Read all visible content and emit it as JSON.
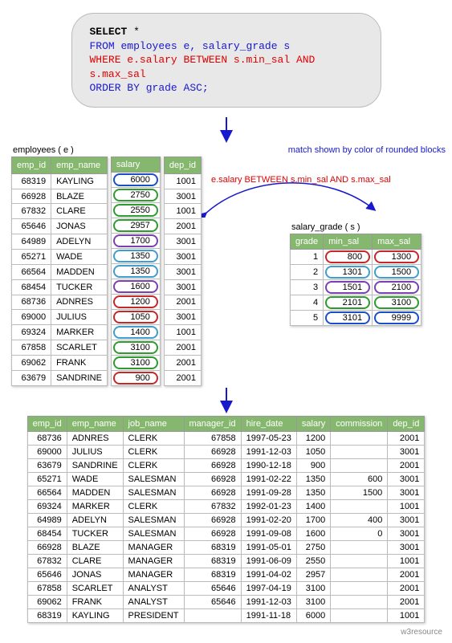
{
  "sql": {
    "select": "SELECT",
    "star": "*",
    "from": "FROM employees e, salary_grade s",
    "where": "WHERE e.salary BETWEEN s.min_sal AND s.max_sal",
    "order": "ORDER BY grade ASC;"
  },
  "notes": {
    "match_color": "match shown by color of rounded blocks",
    "between": "e.salary BETWEEN s.min_sal AND s.max_sal"
  },
  "employees_caption": "employees ( e )",
  "employees_headers": {
    "emp_id": "emp_id",
    "emp_name": "emp_name",
    "salary": "salary",
    "dep_id": "dep_id"
  },
  "employees": [
    {
      "emp_id": "68319",
      "emp_name": "KAYLING",
      "salary": "6000",
      "grade": "g5",
      "dep_id": "1001"
    },
    {
      "emp_id": "66928",
      "emp_name": "BLAZE",
      "salary": "2750",
      "grade": "g4",
      "dep_id": "3001"
    },
    {
      "emp_id": "67832",
      "emp_name": "CLARE",
      "salary": "2550",
      "grade": "g4",
      "dep_id": "1001"
    },
    {
      "emp_id": "65646",
      "emp_name": "JONAS",
      "salary": "2957",
      "grade": "g4",
      "dep_id": "2001"
    },
    {
      "emp_id": "64989",
      "emp_name": "ADELYN",
      "salary": "1700",
      "grade": "g3",
      "dep_id": "3001"
    },
    {
      "emp_id": "65271",
      "emp_name": "WADE",
      "salary": "1350",
      "grade": "g2",
      "dep_id": "3001"
    },
    {
      "emp_id": "66564",
      "emp_name": "MADDEN",
      "salary": "1350",
      "grade": "g2",
      "dep_id": "3001"
    },
    {
      "emp_id": "68454",
      "emp_name": "TUCKER",
      "salary": "1600",
      "grade": "g3",
      "dep_id": "3001"
    },
    {
      "emp_id": "68736",
      "emp_name": "ADNRES",
      "salary": "1200",
      "grade": "g1",
      "dep_id": "2001"
    },
    {
      "emp_id": "69000",
      "emp_name": "JULIUS",
      "salary": "1050",
      "grade": "g1",
      "dep_id": "3001"
    },
    {
      "emp_id": "69324",
      "emp_name": "MARKER",
      "salary": "1400",
      "grade": "g2",
      "dep_id": "1001"
    },
    {
      "emp_id": "67858",
      "emp_name": "SCARLET",
      "salary": "3100",
      "grade": "g4",
      "dep_id": "2001"
    },
    {
      "emp_id": "69062",
      "emp_name": "FRANK",
      "salary": "3100",
      "grade": "g4",
      "dep_id": "2001"
    },
    {
      "emp_id": "63679",
      "emp_name": "SANDRINE",
      "salary": "900",
      "grade": "g1",
      "dep_id": "2001"
    }
  ],
  "grade_caption": "salary_grade ( s )",
  "grade_headers": {
    "grade": "grade",
    "min_sal": "min_sal",
    "max_sal": "max_sal"
  },
  "grades": [
    {
      "grade": "1",
      "min": "800",
      "max": "1300",
      "cls": "g1"
    },
    {
      "grade": "2",
      "min": "1301",
      "max": "1500",
      "cls": "g2"
    },
    {
      "grade": "3",
      "min": "1501",
      "max": "2100",
      "cls": "g3"
    },
    {
      "grade": "4",
      "min": "2101",
      "max": "3100",
      "cls": "g4"
    },
    {
      "grade": "5",
      "min": "3101",
      "max": "9999",
      "cls": "g5"
    }
  ],
  "result_headers": {
    "emp_id": "emp_id",
    "emp_name": "emp_name",
    "job_name": "job_name",
    "manager_id": "manager_id",
    "hire_date": "hire_date",
    "salary": "salary",
    "commission": "commission",
    "dep_id": "dep_id"
  },
  "result": [
    {
      "emp_id": "68736",
      "emp_name": "ADNRES",
      "job": "CLERK",
      "mgr": "67858",
      "hire": "1997-05-23",
      "sal": "1200",
      "comm": "",
      "dep": "2001"
    },
    {
      "emp_id": "69000",
      "emp_name": "JULIUS",
      "job": "CLERK",
      "mgr": "66928",
      "hire": "1991-12-03",
      "sal": "1050",
      "comm": "",
      "dep": "3001"
    },
    {
      "emp_id": "63679",
      "emp_name": "SANDRINE",
      "job": "CLERK",
      "mgr": "66928",
      "hire": "1990-12-18",
      "sal": "900",
      "comm": "",
      "dep": "2001"
    },
    {
      "emp_id": "65271",
      "emp_name": "WADE",
      "job": "SALESMAN",
      "mgr": "66928",
      "hire": "1991-02-22",
      "sal": "1350",
      "comm": "600",
      "dep": "3001"
    },
    {
      "emp_id": "66564",
      "emp_name": "MADDEN",
      "job": "SALESMAN",
      "mgr": "66928",
      "hire": "1991-09-28",
      "sal": "1350",
      "comm": "1500",
      "dep": "3001"
    },
    {
      "emp_id": "69324",
      "emp_name": "MARKER",
      "job": "CLERK",
      "mgr": "67832",
      "hire": "1992-01-23",
      "sal": "1400",
      "comm": "",
      "dep": "1001"
    },
    {
      "emp_id": "64989",
      "emp_name": "ADELYN",
      "job": "SALESMAN",
      "mgr": "66928",
      "hire": "1991-02-20",
      "sal": "1700",
      "comm": "400",
      "dep": "3001"
    },
    {
      "emp_id": "68454",
      "emp_name": "TUCKER",
      "job": "SALESMAN",
      "mgr": "66928",
      "hire": "1991-09-08",
      "sal": "1600",
      "comm": "0",
      "dep": "3001"
    },
    {
      "emp_id": "66928",
      "emp_name": "BLAZE",
      "job": "MANAGER",
      "mgr": "68319",
      "hire": "1991-05-01",
      "sal": "2750",
      "comm": "",
      "dep": "3001"
    },
    {
      "emp_id": "67832",
      "emp_name": "CLARE",
      "job": "MANAGER",
      "mgr": "68319",
      "hire": "1991-06-09",
      "sal": "2550",
      "comm": "",
      "dep": "1001"
    },
    {
      "emp_id": "65646",
      "emp_name": "JONAS",
      "job": "MANAGER",
      "mgr": "68319",
      "hire": "1991-04-02",
      "sal": "2957",
      "comm": "",
      "dep": "2001"
    },
    {
      "emp_id": "67858",
      "emp_name": "SCARLET",
      "job": "ANALYST",
      "mgr": "65646",
      "hire": "1997-04-19",
      "sal": "3100",
      "comm": "",
      "dep": "2001"
    },
    {
      "emp_id": "69062",
      "emp_name": "FRANK",
      "job": "ANALYST",
      "mgr": "65646",
      "hire": "1991-12-03",
      "sal": "3100",
      "comm": "",
      "dep": "2001"
    },
    {
      "emp_id": "68319",
      "emp_name": "KAYLING",
      "job": "PRESIDENT",
      "mgr": "",
      "hire": "1991-11-18",
      "sal": "6000",
      "comm": "",
      "dep": "1001"
    }
  ],
  "footer": "w3resource"
}
